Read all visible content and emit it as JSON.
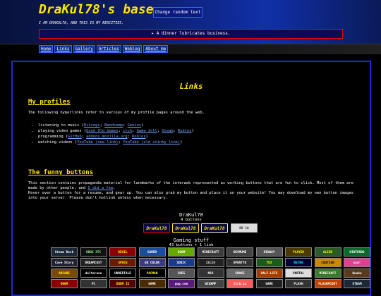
{
  "site": {
    "title": "DraKul78's base",
    "random_text_button": "Change random text",
    "subtitle": "I AM DRAKUL78, AND THIS IS MY NEOCITIES.",
    "ticker": "▸ A dinner lubricates business."
  },
  "nav": [
    "Home",
    "Links",
    "Gallery",
    "Articles",
    "Weblog",
    "About me"
  ],
  "page": {
    "title": "Links"
  },
  "profiles": {
    "heading": "My profiles",
    "intro": "The following hyperlinks refer to various of my profile pages around the web.",
    "items": [
      {
        "prefix": "listening to music (",
        "links": [
          "Discogs",
          "Bandcamp",
          "Genius"
        ],
        "suffix": ")"
      },
      {
        "prefix": "playing video games (",
        "links": [
          "Good Old Games",
          "itch",
          "Game Jolt",
          "Steam",
          "Roblox"
        ],
        "suffix": ")"
      },
      {
        "prefix": "programming (",
        "links": [
          "GitHub",
          "addons.mozilla.org",
          "Roblox"
        ],
        "suffix": ")"
      },
      {
        "prefix": "watching videos (",
        "links": [
          "YouTube (new link)",
          "YouTube (old stinky link)"
        ],
        "suffix": ")"
      }
    ]
  },
  "buttons_section": {
    "heading": "The funny buttons",
    "para1_a": "This section contains propaganda material for landmarks of the interweb represented as working buttons that are fun to click. Most of them are made by other people, and ",
    "para1_link": "I did a few",
    "para1_b": ".",
    "para2": "Hover over a button for a resume, and gear up. You can also grab my button and place it on your website! You may download my own button images into your server. Please don't hotlink unless when necessary."
  },
  "group_drakul": {
    "title": "DraKul78",
    "count": "4 buttons",
    "buttons": [
      "DraKul78",
      "DraKul78",
      "DraKul78",
      "BR 10"
    ]
  },
  "group_gaming": {
    "title": "Gaming stuff",
    "count": "43 buttons + 1 link",
    "buttons": [
      {
        "label": "Steam Deck",
        "bg": "#1b2838",
        "fg": "#fff"
      },
      {
        "label": "XBOX 3TC",
        "bg": "#111",
        "fg": "#9f9"
      },
      {
        "label": "DEVIL",
        "bg": "#8a0000",
        "fg": "#ff0"
      },
      {
        "label": "GAMER",
        "bg": "#1a4d9c",
        "fg": "#fff"
      },
      {
        "label": "DOOM",
        "bg": "#6a0",
        "fg": "#fff"
      },
      {
        "label": "MINECRAFT",
        "bg": "#3c3c3c",
        "fg": "#fff"
      },
      {
        "label": "DESMUME",
        "bg": "#444",
        "fg": "#fff"
      },
      {
        "label": "RINWAY",
        "bg": "#555",
        "fg": "#fff"
      },
      {
        "label": "PLAYER",
        "bg": "#4a3a00",
        "fg": "#ff0"
      },
      {
        "label": "ALIEN",
        "bg": "#2a5a2a",
        "fg": "#ff0"
      },
      {
        "label": "NINTENDO",
        "bg": "#0a6a2a",
        "fg": "#fff"
      },
      {
        "label": "Cave Story",
        "bg": "#223",
        "fg": "#fff"
      },
      {
        "label": "DREAMCAST",
        "bg": "#222",
        "fg": "#fff"
      },
      {
        "label": "SPACE",
        "bg": "#6a1a00",
        "fg": "#ff0"
      },
      {
        "label": "GB COLOR",
        "bg": "#3a3a80",
        "fg": "#fff"
      },
      {
        "label": "SONIC",
        "bg": "#1a3a8a",
        "fg": "#fff"
      },
      {
        "label": "ZELDA",
        "bg": "#222",
        "fg": "#ccc"
      },
      {
        "label": "OPENTTD",
        "bg": "#333",
        "fg": "#fff"
      },
      {
        "label": "TUX",
        "bg": "#1a5a1a",
        "fg": "#ff0"
      },
      {
        "label": "RETRO",
        "bg": "#003",
        "fg": "#0ff"
      },
      {
        "label": "CAUTION",
        "bg": "#c80",
        "fg": "#000"
      },
      {
        "label": "osu!",
        "bg": "#e04090",
        "fg": "#fff"
      },
      {
        "label": "ARCADE",
        "bg": "#7a4a00",
        "fg": "#ff0"
      },
      {
        "label": "deltarune",
        "bg": "#000",
        "fg": "#fff"
      },
      {
        "label": "UNDERTALE",
        "bg": "#000",
        "fg": "#fff"
      },
      {
        "label": "PACMAN",
        "bg": "#000",
        "fg": "#ff0"
      },
      {
        "label": "SNES",
        "bg": "#555",
        "fg": "#fff"
      },
      {
        "label": "N64",
        "bg": "#333",
        "fg": "#fff"
      },
      {
        "label": "SNAKE",
        "bg": "#6a6a6a",
        "fg": "#fff"
      },
      {
        "label": "HALF-LIFE",
        "bg": "#a04000",
        "fg": "#fff"
      },
      {
        "label": "PORTAL",
        "bg": "#ddd",
        "fg": "#000"
      },
      {
        "label": "MINECRAFT",
        "bg": "#3a7a2a",
        "fg": "#fff"
      },
      {
        "label": "Quake",
        "bg": "#5a3a1a",
        "fg": "#fff"
      },
      {
        "label": "DOOM",
        "bg": "#800",
        "fg": "#ff0"
      },
      {
        "label": "PC",
        "bg": "#333",
        "fg": "#fff"
      },
      {
        "label": "DOOM II",
        "bg": "#500",
        "fg": "#ff0"
      },
      {
        "label": "GAME",
        "bg": "#4a2a00",
        "fg": "#fff"
      },
      {
        "label": "gog.com",
        "bg": "#5a1a7a",
        "fg": "#fff"
      },
      {
        "label": "WINAMP",
        "bg": "#444",
        "fg": "#fff"
      },
      {
        "label": "itch.io",
        "bg": "#fa5c5c",
        "fg": "#fff"
      },
      {
        "label": "GAME",
        "bg": "#222",
        "fg": "#fff"
      },
      {
        "label": "FLASH",
        "bg": "#333",
        "fg": "#fff"
      },
      {
        "label": "FLASHPOINT",
        "bg": "#c04000",
        "fg": "#fff"
      },
      {
        "label": "STEAM",
        "bg": "#1b2838",
        "fg": "#fff"
      }
    ]
  }
}
